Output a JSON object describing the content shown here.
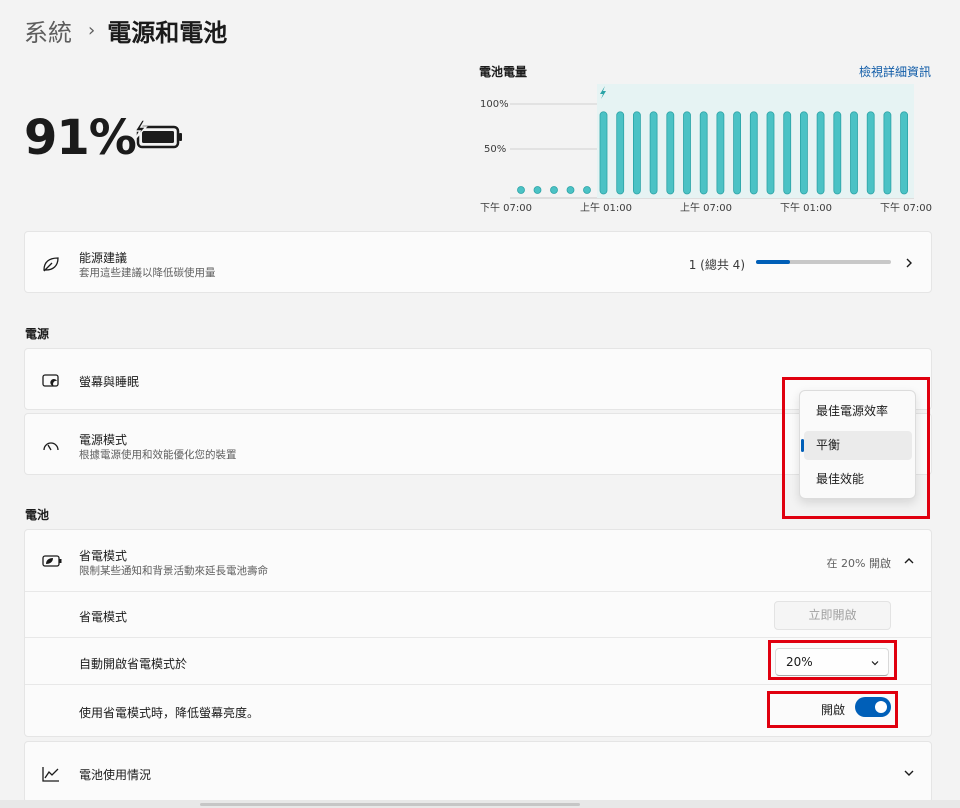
{
  "breadcrumb": {
    "parent": "系統",
    "separator": "›",
    "current": "電源和電池"
  },
  "battery": {
    "percent_text": "91%",
    "level": 0.91,
    "charging": true
  },
  "chart": {
    "title": "電池電量",
    "link": "檢視詳細資訊",
    "y_ticks": [
      "100%",
      "50%"
    ],
    "x_ticks": [
      "下午 07:00",
      "上午 01:00",
      "上午 07:00",
      "下午 01:00",
      "下午 07:00"
    ]
  },
  "chart_data": {
    "type": "bar",
    "title": "電池電量",
    "xlabel": "",
    "ylabel": "",
    "ylim": [
      0,
      100
    ],
    "y_ticks": [
      "100%",
      "50%"
    ],
    "x_ticks": [
      "下午 07:00",
      "上午 01:00",
      "上午 07:00",
      "下午 01:00",
      "下午 07:00"
    ],
    "pre_charge_points": 5,
    "pre_charge_value": 0,
    "charging_bars": [
      91,
      91,
      91,
      91,
      91,
      91,
      91,
      91,
      91,
      91,
      91,
      91,
      91,
      91,
      91,
      91,
      91,
      91,
      91
    ],
    "charging_marker": "bolt",
    "colors": {
      "bar": "#4bc2c5",
      "bar_stroke": "#2ba3a6",
      "charging_bg": "#e6f3f3",
      "grid": "#d0d0d0"
    }
  },
  "energy": {
    "title": "能源建議",
    "subtitle": "套用這些建議以降低碳使用量",
    "progress_label": "1 (總共 4)",
    "progress": 0.25
  },
  "power_section": {
    "header": "電源",
    "screen_sleep": {
      "title": "螢幕與睡眠"
    },
    "power_mode": {
      "title": "電源模式",
      "subtitle": "根據電源使用和效能優化您的裝置",
      "options": [
        "最佳電源效率",
        "平衡",
        "最佳效能"
      ],
      "selected": "平衡"
    }
  },
  "battery_section": {
    "header": "電池",
    "saver": {
      "title": "省電模式",
      "subtitle": "限制某些通知和背景活動來延長電池壽命",
      "status": "在 20% 開啟",
      "rows": {
        "saver_label": "省電模式",
        "turn_on_now": "立即開啟",
        "auto_label": "自動開啟省電模式於",
        "auto_value": "20%",
        "dim_label": "使用省電模式時，降低螢幕亮度。",
        "dim_state": "開啟"
      }
    },
    "usage": {
      "title": "電池使用情況"
    }
  },
  "colors": {
    "accent": "#005fb8",
    "highlight": "#e0000f",
    "chart_bar": "#4bc2c5"
  }
}
